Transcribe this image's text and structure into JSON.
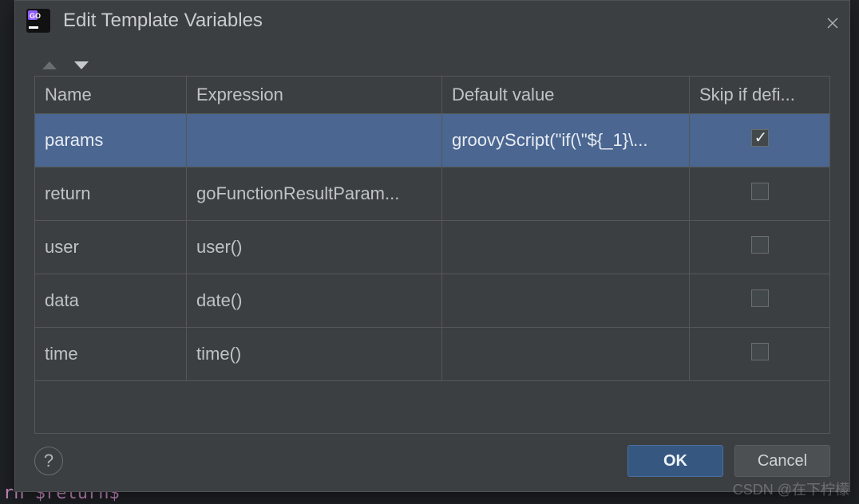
{
  "dialog": {
    "title": "Edit Template Variables"
  },
  "table": {
    "headers": {
      "name": "Name",
      "expression": "Expression",
      "default": "Default value",
      "skip": "Skip if defi..."
    },
    "rows": [
      {
        "name": "params",
        "expression": "",
        "default": "groovyScript(\"if(\\\"${_1}\\...",
        "skip": true,
        "selected": true
      },
      {
        "name": "return",
        "expression": "goFunctionResultParam...",
        "default": "",
        "skip": false,
        "selected": false
      },
      {
        "name": "user",
        "expression": "user()",
        "default": "",
        "skip": false,
        "selected": false
      },
      {
        "name": "data",
        "expression": "date()",
        "default": "",
        "skip": false,
        "selected": false
      },
      {
        "name": "time",
        "expression": "time()",
        "default": "",
        "skip": false,
        "selected": false
      }
    ]
  },
  "buttons": {
    "help": "?",
    "ok": "OK",
    "cancel": "Cancel"
  },
  "watermark": "CSDN @在下柠檬",
  "bg": {
    "line1": "rn $return$"
  }
}
